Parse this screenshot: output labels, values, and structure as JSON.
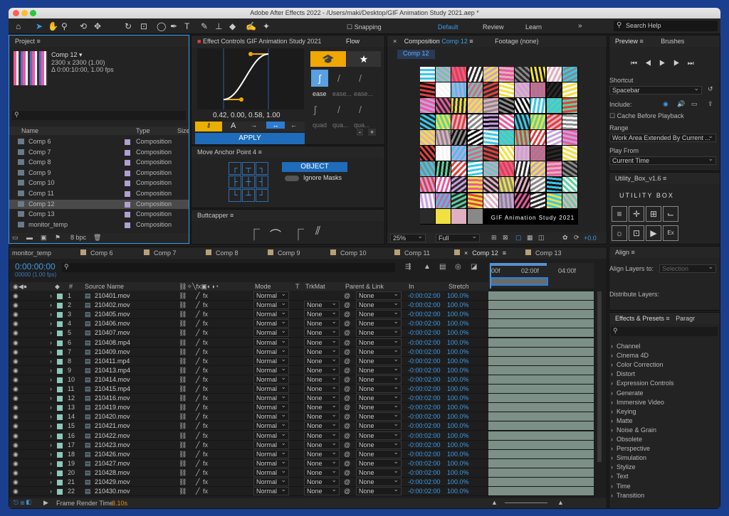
{
  "window": {
    "title": "Adobe After Effects 2022 - /Users/maki/Desktop/GIF Animation Study 2021.aep *"
  },
  "toolbar": {
    "snapping": "Snapping",
    "workspaces": [
      "Default",
      "Review",
      "Learn"
    ],
    "search_placeholder": "Search Help"
  },
  "project": {
    "tab": "Project",
    "comp_name": "Comp 12 ▾",
    "comp_size": "2300 x 2300 (1.00)",
    "comp_duration": "Δ 0:00:10:00, 1.00 fps",
    "col_name": "Name",
    "col_type": "Type",
    "col_size": "Size",
    "bpc": "8 bpc",
    "items": [
      {
        "name": "Comp 6",
        "type": "Composition",
        "color": "#b0a0d0"
      },
      {
        "name": "Comp 7",
        "type": "Composition",
        "color": "#b0a0d0"
      },
      {
        "name": "Comp 8",
        "type": "Composition",
        "color": "#b0a0d0"
      },
      {
        "name": "Comp 9",
        "type": "Composition",
        "color": "#b0a0d0"
      },
      {
        "name": "Comp 10",
        "type": "Composition",
        "color": "#b0a0d0"
      },
      {
        "name": "Comp 11",
        "type": "Composition",
        "color": "#b0a0d0"
      },
      {
        "name": "Comp 12",
        "type": "Composition",
        "color": "#b0a0d0"
      },
      {
        "name": "Comp 13",
        "type": "Composition",
        "color": "#b0a0d0"
      },
      {
        "name": "monitor_temp",
        "type": "Composition",
        "color": "#b0a0d0"
      }
    ]
  },
  "effects": {
    "tab": "Effect Controls GIF Animation Study 2021",
    "flow_tab": "Flow",
    "curve_value": "0.42, 0.00, 0.58, 1.00",
    "apply": "APPLY",
    "ease": [
      "ease",
      "ease...",
      "ease..."
    ],
    "quad": [
      "quad",
      "qua...",
      "qua..."
    ]
  },
  "anchor": {
    "tab": "Move Anchor Point 4",
    "object": "OBJECT",
    "ignore_masks": "Ignore Masks"
  },
  "buttcapper": {
    "tab": "Buttcapper"
  },
  "composition": {
    "tab": "Composition",
    "tab_comp": "Comp 12",
    "footage": "Footage (none)",
    "crumb": "Comp 12",
    "banner": "GIF Animation Study 2021",
    "zoom": "25%",
    "quality": "Full",
    "exposure": "+0.0"
  },
  "preview": {
    "tab": "Preview",
    "brushes": "Brushes",
    "shortcut_label": "Shortcut",
    "shortcut": "Spacebar",
    "include": "Include:",
    "cache": "Cache Before Playback",
    "range_label": "Range",
    "range": "Work Area Extended By Current ...",
    "play_from_label": "Play From",
    "play_from": "Current Time"
  },
  "utility": {
    "tab": "Utility_Box_v1.6",
    "logo": "UTILITY BOX"
  },
  "align": {
    "tab": "Align",
    "align_to": "Align Layers to:",
    "selection": "Selection",
    "distribute": "Distribute Layers:"
  },
  "fx_presets": {
    "tab": "Effects & Presets",
    "tab2": "Paragr",
    "items": [
      "Channel",
      "Cinema 4D",
      "Color Correction",
      "Distort",
      "Expression Controls",
      "Generate",
      "Immersive Video",
      "Keying",
      "Matte",
      "Noise & Grain",
      "Obsolete",
      "Perspective",
      "Simulation",
      "Stylize",
      "Text",
      "Time",
      "Transition"
    ]
  },
  "timeline": {
    "tabs": [
      "monitor_temp",
      "Comp 6",
      "Comp 7",
      "Comp 8",
      "Comp 9",
      "Comp 10",
      "Comp 11",
      "Comp 12",
      "Comp 13"
    ],
    "timecode": "0:00:00:00",
    "fps": "00000 (1.00 fps)",
    "ruler": [
      "00f",
      "02:00f",
      "04:00f"
    ],
    "headers": {
      "num": "#",
      "source": "Source Name",
      "mode": "Mode",
      "t": "T",
      "trkmat": "TrkMat",
      "parent": "Parent & Link",
      "in": "In",
      "stretch": "Stretch"
    },
    "mode_val": "Normal",
    "none_val": "None",
    "in_val": "-0:00:02:00",
    "stretch_val": "100.0%",
    "layers": [
      {
        "n": "1",
        "name": "210401.mov"
      },
      {
        "n": "2",
        "name": "210402.mov"
      },
      {
        "n": "3",
        "name": "210405.mov"
      },
      {
        "n": "4",
        "name": "210406.mov"
      },
      {
        "n": "5",
        "name": "210407.mov"
      },
      {
        "n": "6",
        "name": "210408.mp4"
      },
      {
        "n": "7",
        "name": "210409.mov"
      },
      {
        "n": "8",
        "name": "210411.mp4"
      },
      {
        "n": "9",
        "name": "210413.mp4"
      },
      {
        "n": "10",
        "name": "210414.mov"
      },
      {
        "n": "11",
        "name": "210415.mp4"
      },
      {
        "n": "12",
        "name": "210416.mov"
      },
      {
        "n": "13",
        "name": "210419.mov"
      },
      {
        "n": "14",
        "name": "210420.mov"
      },
      {
        "n": "15",
        "name": "210421.mov"
      },
      {
        "n": "16",
        "name": "210422.mov"
      },
      {
        "n": "17",
        "name": "210423.mov"
      },
      {
        "n": "18",
        "name": "210426.mov"
      },
      {
        "n": "19",
        "name": "210427.mov"
      },
      {
        "n": "20",
        "name": "210428.mov"
      },
      {
        "n": "21",
        "name": "210429.mov"
      },
      {
        "n": "22",
        "name": "210430.mov"
      }
    ],
    "status_label": "Frame Render Time",
    "status_value": "3.10s"
  }
}
